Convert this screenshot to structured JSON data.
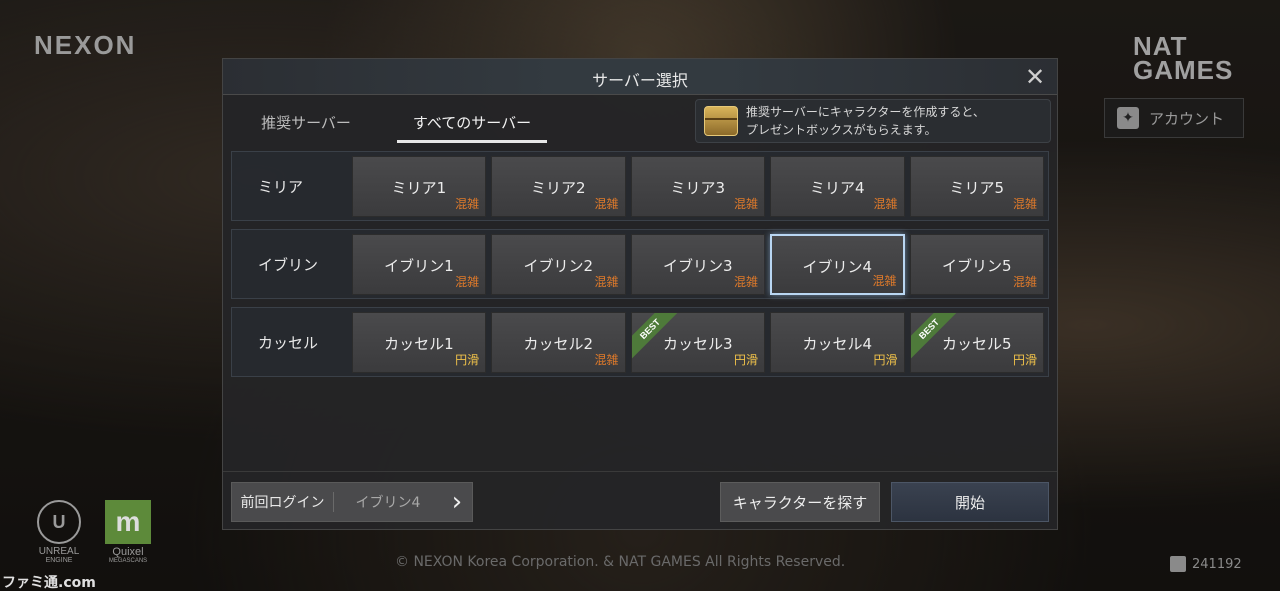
{
  "background": {
    "nexon_logo": "NEXON",
    "nat_logo_line1": "NAT",
    "nat_logo_line2": "GAMES",
    "account_label": "アカウント",
    "unreal_label_1": "UNREAL",
    "unreal_label_2": "ENGINE",
    "quixel_label": "Quixel",
    "quixel_sub": "MEGASCANS",
    "copyright": "© NEXON Korea Corporation. & NAT GAMES All Rights Reserved.",
    "build_number": "241192",
    "watermark": "ファミ通.com"
  },
  "modal": {
    "title": "サーバー選択",
    "tabs": [
      {
        "label": "推奨サーバー"
      },
      {
        "label": "すべてのサーバー"
      }
    ],
    "notice_line1": "推奨サーバーにキャラクターを作成すると、",
    "notice_line2": "プレゼントボックスがもらえます。",
    "groups": [
      {
        "name": "ミリア",
        "servers": [
          {
            "name": "ミリア1",
            "status": "混雑"
          },
          {
            "name": "ミリア2",
            "status": "混雑"
          },
          {
            "name": "ミリア3",
            "status": "混雑"
          },
          {
            "name": "ミリア4",
            "status": "混雑"
          },
          {
            "name": "ミリア5",
            "status": "混雑"
          }
        ]
      },
      {
        "name": "イブリン",
        "servers": [
          {
            "name": "イブリン1",
            "status": "混雑"
          },
          {
            "name": "イブリン2",
            "status": "混雑"
          },
          {
            "name": "イブリン3",
            "status": "混雑"
          },
          {
            "name": "イブリン4",
            "status": "混雑"
          },
          {
            "name": "イブリン5",
            "status": "混雑"
          }
        ]
      },
      {
        "name": "カッセル",
        "servers": [
          {
            "name": "カッセル1",
            "status": "円滑"
          },
          {
            "name": "カッセル2",
            "status": "混雑"
          },
          {
            "name": "カッセル3",
            "status": "円滑"
          },
          {
            "name": "カッセル4",
            "status": "円滑"
          },
          {
            "name": "カッセル5",
            "status": "円滑"
          }
        ]
      }
    ],
    "best_badge": "BEST",
    "last_login_label": "前回ログイン",
    "last_login_server": "イブリン4",
    "find_character_label": "キャラクターを探す",
    "start_label": "開始",
    "colors": {
      "busy": "#e07a2a",
      "smooth": "#f0c24a",
      "best_badge": "#4e7a3a",
      "selected_border": "#b9d6f2"
    }
  }
}
